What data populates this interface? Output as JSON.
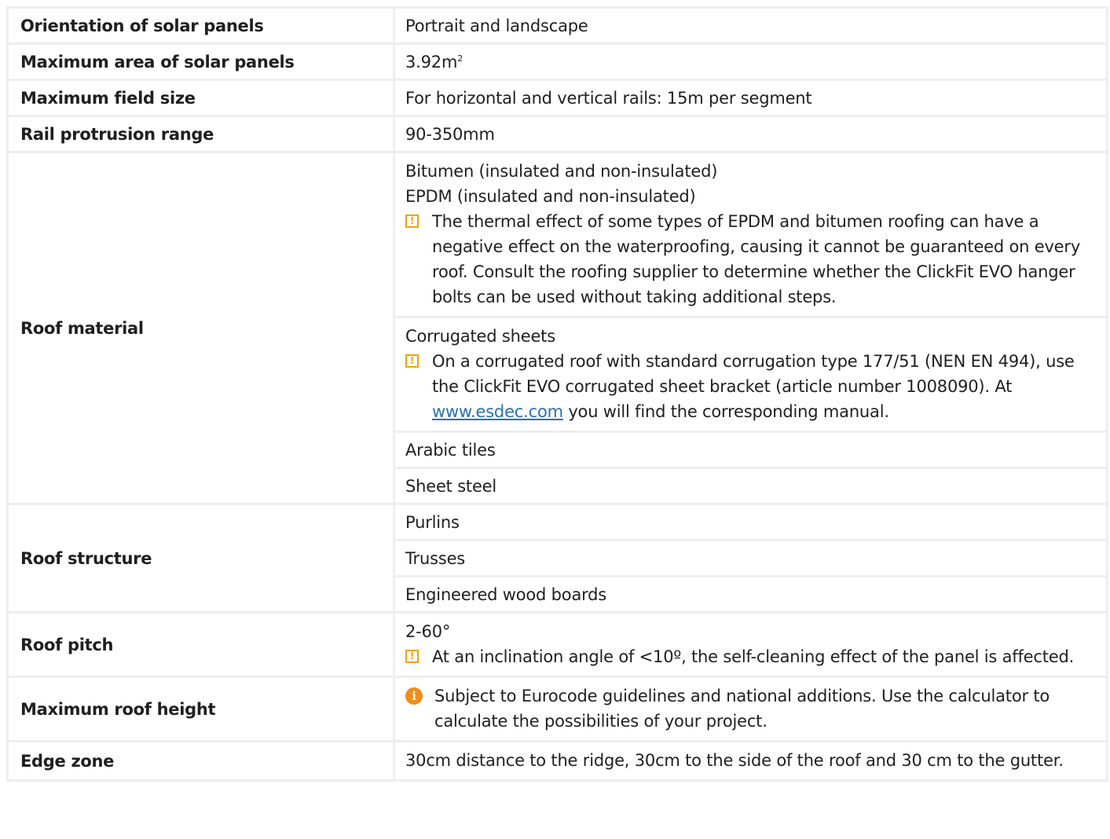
{
  "rows": {
    "orientation": {
      "label": "Orientation of solar panels",
      "value": "Portrait and landscape"
    },
    "max_area": {
      "label": "Maximum area of solar panels",
      "value": "3.92m",
      "sup": "2"
    },
    "field_size": {
      "label": "Maximum field size",
      "value": "For horizontal and vertical rails: 15m per segment"
    },
    "rail_protrusion": {
      "label": "Rail protrusion range",
      "value": "90-350mm"
    },
    "roof_material": {
      "label": "Roof material",
      "bitumen": "Bitumen (insulated and non-insulated)",
      "epdm": "EPDM (insulated and non-insulated)",
      "epdm_note": "The thermal effect of some types of EPDM and bitumen roofing can have a negative effect on the waterproofing, causing it cannot be guaranteed on every roof. Consult the roofing supplier to determine whether the ClickFit EVO hanger bolts can be used without taking additional steps.",
      "corrugated": "Corrugated sheets",
      "corrugated_note_before": "On a corrugated roof with standard corrugation type 177/51 (NEN EN 494), use the ClickFit EVO corrugated sheet bracket (article number 1008090). At ",
      "corrugated_note_link": "www.esdec.com",
      "corrugated_note_after": " you will find the corresponding manual.",
      "arabic": "Arabic tiles",
      "steel": "Sheet steel"
    },
    "roof_structure": {
      "label": "Roof structure",
      "items": [
        "Purlins",
        "Trusses",
        "Engineered wood boards"
      ]
    },
    "roof_pitch": {
      "label": "Roof pitch",
      "value": "2-60°",
      "note": "At an inclination angle of <10º, the self-cleaning effect of the panel is affected."
    },
    "max_height": {
      "label": "Maximum roof height",
      "note": "Subject to Eurocode guidelines and national additions. Use the calculator to calculate the possibilities of your project."
    },
    "edge_zone": {
      "label": "Edge zone",
      "value": "30cm distance to the ridge, 30cm to the side of the roof and 30 cm to the gutter."
    }
  },
  "icons": {
    "warning": "warning-icon",
    "info": "info-icon",
    "warning_glyph": "!",
    "info_glyph": "i"
  },
  "colors": {
    "warning": "#f5a100",
    "info": "#f08c1a",
    "link": "#2a6fb5",
    "border": "#eeeeee"
  }
}
